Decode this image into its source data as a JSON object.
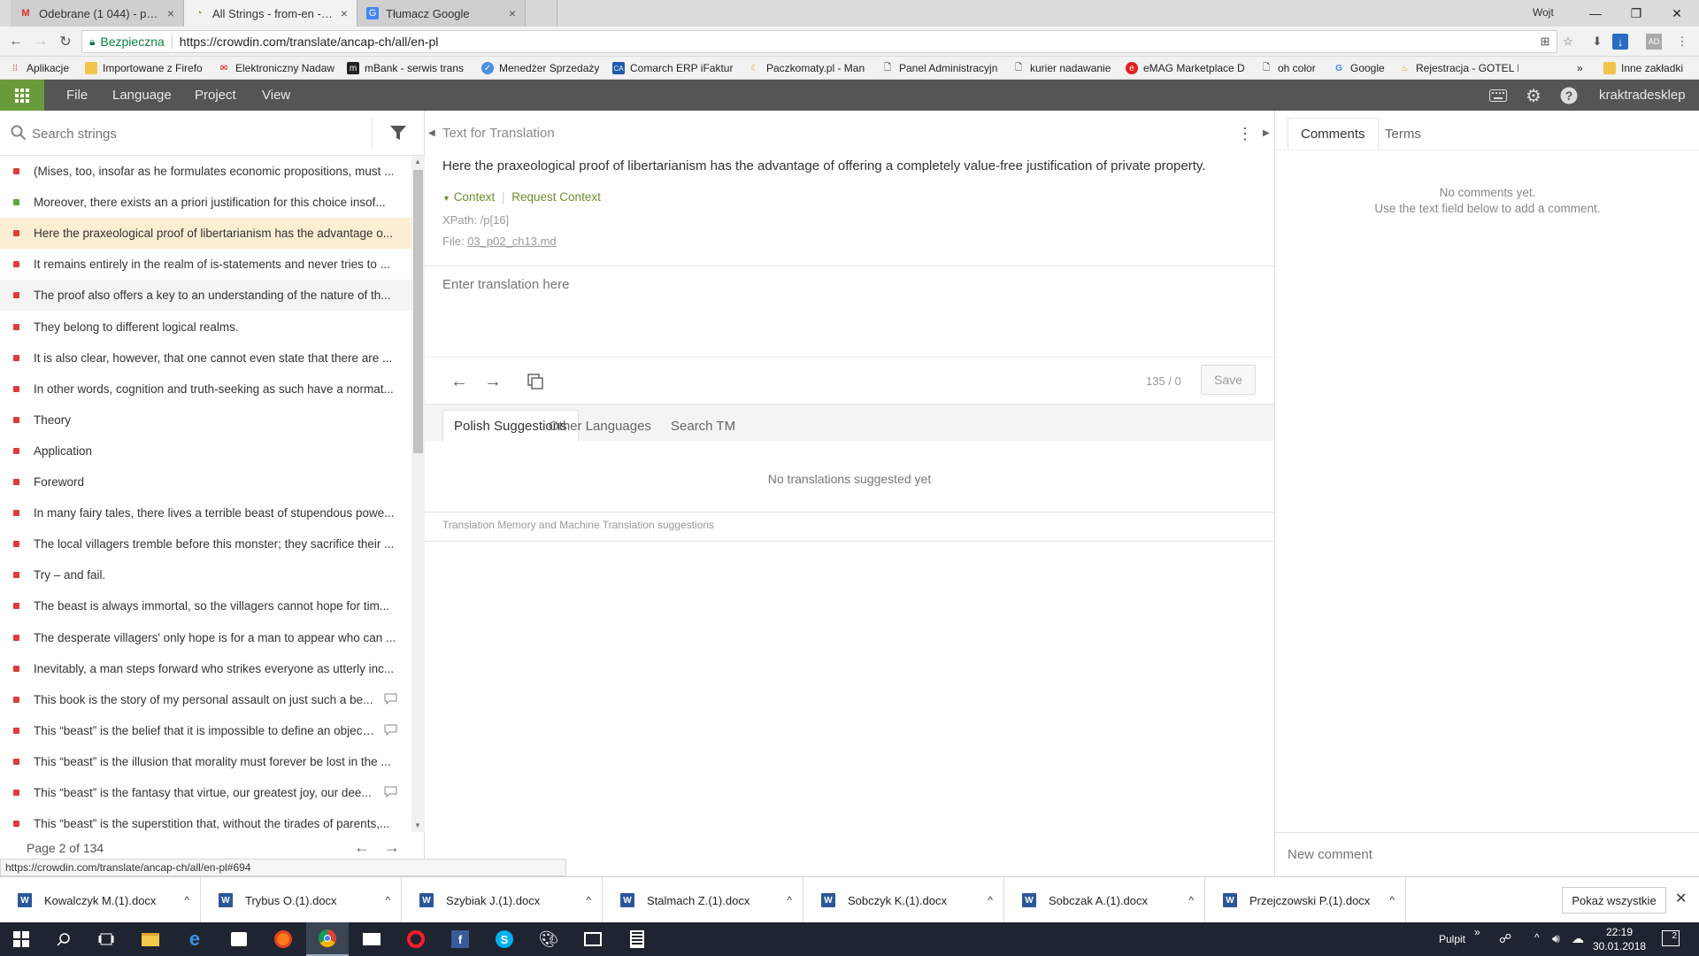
{
  "browser": {
    "tabs": [
      {
        "title": "Odebrane (1 044) - pain...",
        "icon": "gmail-icon"
      },
      {
        "title": "All Strings - from-en - Cr",
        "icon": "crowdin-icon"
      },
      {
        "title": "Tłumacz Google",
        "icon": "google-translate-icon"
      }
    ],
    "user_label": "Wojt",
    "secure_label": "Bezpieczna",
    "url": "https://crowdin.com/translate/ancap-ch/all/en-pl",
    "bookmarks": [
      {
        "label": "Aplikacje"
      },
      {
        "label": "Importowane z Firefo"
      },
      {
        "label": "Elektroniczny Nadaw"
      },
      {
        "label": "mBank - serwis trans"
      },
      {
        "label": "Menedżer Sprzedaży"
      },
      {
        "label": "Comarch ERP iFaktur"
      },
      {
        "label": "Paczkomaty.pl - Man"
      },
      {
        "label": "Panel Administracyjn"
      },
      {
        "label": "kurier nadawanie"
      },
      {
        "label": "eMAG Marketplace D"
      },
      {
        "label": "oh color"
      },
      {
        "label": "Google"
      },
      {
        "label": "Rejestracja - GOTEL I"
      }
    ],
    "more_bookmarks": "»",
    "other_bookmarks": "Inne zakładki",
    "status_url": "https://crowdin.com/translate/ancap-ch/all/en-pl#694"
  },
  "app": {
    "menu": [
      "File",
      "Language",
      "Project",
      "View"
    ],
    "username": "kraktradesklep"
  },
  "left": {
    "search_placeholder": "Search strings",
    "strings": [
      {
        "text": "(Mises, too, insofar as he formulates economic propositions, must ...",
        "status": "untranslated"
      },
      {
        "text": "Moreover, there exists an a priori justification for this choice insof...",
        "status": "translated"
      },
      {
        "text": "Here the praxeological proof of libertarianism has the advantage o...",
        "status": "untranslated",
        "selected": true
      },
      {
        "text": "It remains entirely in the realm of is-statements and never tries to ...",
        "status": "untranslated"
      },
      {
        "text": "The proof also offers a key to an understanding of the nature of th...",
        "status": "untranslated"
      },
      {
        "text": "They belong to different logical realms.",
        "status": "untranslated"
      },
      {
        "text": "It is also clear, however, that one cannot even state that there are ...",
        "status": "untranslated"
      },
      {
        "text": "In other words, cognition and truth-seeking as such have a normat...",
        "status": "untranslated"
      },
      {
        "text": "Theory",
        "status": "untranslated"
      },
      {
        "text": "Application",
        "status": "untranslated"
      },
      {
        "text": "Foreword",
        "status": "untranslated"
      },
      {
        "text": "In many fairy tales, there lives a terrible beast of stupendous powe...",
        "status": "untranslated"
      },
      {
        "text": "The local villagers tremble before this monster; they sacrifice their ...",
        "status": "untranslated"
      },
      {
        "text": "Try – and fail.",
        "status": "untranslated"
      },
      {
        "text": "The beast is always immortal, so the villagers cannot hope for tim...",
        "status": "untranslated"
      },
      {
        "text": "The desperate villagers' only hope is for a man to appear who can ...",
        "status": "untranslated"
      },
      {
        "text": "Inevitably, a man steps forward who strikes everyone as utterly inc...",
        "status": "untranslated"
      },
      {
        "text": "This book is the story of my personal assault on just such a be...",
        "status": "untranslated",
        "comment": true
      },
      {
        "text": "This “beast” is the belief that it is impossible to define an object...",
        "status": "untranslated",
        "comment": true
      },
      {
        "text": "This “beast” is the illusion that morality must forever be lost in the ...",
        "status": "untranslated"
      },
      {
        "text": "This “beast” is the fantasy that virtue, our greatest joy, our dee...",
        "status": "untranslated",
        "comment": true
      },
      {
        "text": "This “beast” is the superstition that, without the tirades of parents,...",
        "status": "untranslated"
      }
    ],
    "pager": "Page 2 of 134"
  },
  "middle": {
    "header": "Text for Translation",
    "source_text": "Here the praxeological proof of libertarianism has the advantage of offering a completely value-free justification of private property.",
    "context_label": "Context",
    "request_context": "Request Context",
    "xpath": "XPath: /p[16]",
    "file_label": "File:",
    "file_name": "03_p02_ch13.md",
    "translation_placeholder": "Enter translation here",
    "counter": "135 / 0",
    "save": "Save",
    "tabs": [
      "Polish Suggestions",
      "Other Languages",
      "Search TM"
    ],
    "no_suggestions": "No translations suggested yet",
    "tm_note": "Translation Memory and Machine Translation suggestions"
  },
  "right": {
    "tabs": [
      "Comments",
      "Terms"
    ],
    "no_comments_1": "No comments yet.",
    "no_comments_2": "Use the text field below to add a comment.",
    "new_comment_placeholder": "New comment"
  },
  "downloads": {
    "files": [
      "Kowalczyk M.(1).docx",
      "Trybus O.(1).docx",
      "Szybiak J.(1).docx",
      "Stalmach Z.(1).docx",
      "Sobczyk K.(1).docx",
      "Sobczak A.(1).docx",
      "Przejczowski P.(1).docx"
    ],
    "show_all": "Pokaż wszystkie"
  },
  "taskbar": {
    "desktop_label": "Pulpit",
    "time": "22:19",
    "date": "30.01.2018",
    "notif_count": "2"
  }
}
